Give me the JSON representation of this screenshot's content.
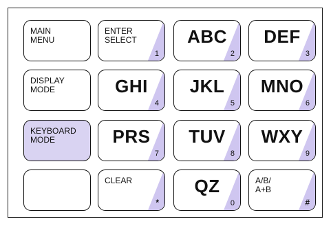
{
  "keypad": {
    "accent_color": "#cfc6f0",
    "active_color": "#d9d3f2",
    "keys": [
      {
        "id": "main-menu",
        "label": "MAIN\nMENU",
        "sub": "",
        "style": "small",
        "active": false
      },
      {
        "id": "enter-select",
        "label": "ENTER\nSELECT",
        "sub": "1",
        "style": "small",
        "active": false
      },
      {
        "id": "abc",
        "label": "ABC",
        "sub": "2",
        "style": "big",
        "active": false
      },
      {
        "id": "def",
        "label": "DEF",
        "sub": "3",
        "style": "big",
        "active": false
      },
      {
        "id": "display-mode",
        "label": "DISPLAY\nMODE",
        "sub": "",
        "style": "small",
        "active": false
      },
      {
        "id": "ghi",
        "label": "GHI",
        "sub": "4",
        "style": "big",
        "active": false
      },
      {
        "id": "jkl",
        "label": "JKL",
        "sub": "5",
        "style": "big",
        "active": false
      },
      {
        "id": "mno",
        "label": "MNO",
        "sub": "6",
        "style": "big",
        "active": false
      },
      {
        "id": "keyboard-mode",
        "label": "KEYBOARD\nMODE",
        "sub": "",
        "style": "small",
        "active": true
      },
      {
        "id": "prs",
        "label": "PRS",
        "sub": "7",
        "style": "big",
        "active": false
      },
      {
        "id": "tuv",
        "label": "TUV",
        "sub": "8",
        "style": "big",
        "active": false
      },
      {
        "id": "wxy",
        "label": "WXY",
        "sub": "9",
        "style": "big",
        "active": false
      },
      {
        "id": "blank",
        "label": "",
        "sub": "",
        "style": "small",
        "active": false
      },
      {
        "id": "clear",
        "label": "CLEAR",
        "sub": "*",
        "style": "small",
        "active": false
      },
      {
        "id": "qz",
        "label": "QZ",
        "sub": "0",
        "style": "big",
        "active": false
      },
      {
        "id": "ab-toggle",
        "label": "A/B/\nA+B",
        "sub": "#",
        "style": "small",
        "active": false
      }
    ]
  }
}
